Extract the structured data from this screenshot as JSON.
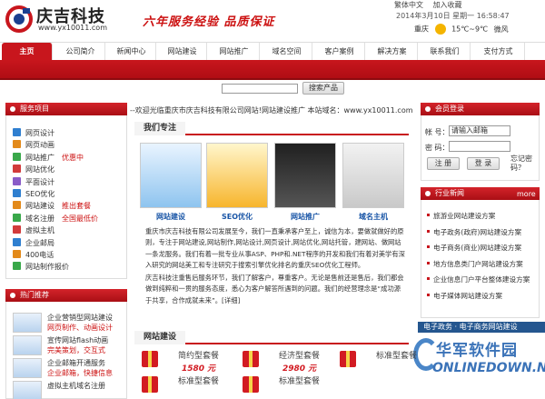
{
  "header": {
    "logo_name": "庆吉科技",
    "logo_url": "www.yx10011.com",
    "slogan": "六年服务经验  品质保证",
    "top_links": [
      "繁体中文",
      "加入收藏"
    ],
    "dateline": "2014年3月10日 星期一  16:58:47",
    "weather": {
      "city": "重庆",
      "temp": "15℃~9℃",
      "wind": "微风"
    }
  },
  "nav": {
    "items": [
      "主页",
      "公司简介",
      "新闻中心",
      "网站建设",
      "网站推广",
      "域名空间",
      "客户案例",
      "解决方案",
      "联系我们",
      "支付方式"
    ],
    "active_index": 0
  },
  "search": {
    "placeholder": "",
    "button": "搜索产品"
  },
  "notice": "--欢迎光临重庆市庆吉科技有限公司网站!网站建设推广  本站域名：www.yx10011.com",
  "services": {
    "title": "服务项目",
    "items": [
      {
        "label": "网页设计",
        "hot": "",
        "color": "#2f7fd0"
      },
      {
        "label": "网页动画",
        "hot": "",
        "color": "#e38a1a"
      },
      {
        "label": "网站推广",
        "hot": "优惠中",
        "color": "#39a84a"
      },
      {
        "label": "网站优化",
        "hot": "",
        "color": "#d23b3b"
      },
      {
        "label": "平面设计",
        "hot": "",
        "color": "#8a5cc8"
      },
      {
        "label": "SEO优化",
        "hot": "",
        "color": "#2f7fd0"
      },
      {
        "label": "网站建设",
        "hot": "推出套餐",
        "color": "#e38a1a"
      },
      {
        "label": "域名注册",
        "hot": "全国最低价",
        "color": "#39a84a"
      },
      {
        "label": "虚拟主机",
        "hot": "",
        "color": "#d23b3b"
      },
      {
        "label": "企业邮局",
        "hot": "",
        "color": "#2f7fd0"
      },
      {
        "label": "400电话",
        "hot": "",
        "color": "#e38a1a"
      },
      {
        "label": "网站制作报价",
        "hot": "",
        "color": "#39a84a"
      }
    ]
  },
  "hot": {
    "title": "热门推荐",
    "items": [
      {
        "title": "企业营销型网站建设",
        "sub": "网页制作、动画设计"
      },
      {
        "title": "宣传网站flash动画",
        "sub": "完美策划，交互式"
      },
      {
        "title": "企业邮箱开通服务",
        "sub": "企业邮箱，快捷信息"
      },
      {
        "title": "虚拟主机域名注册",
        "sub": ""
      }
    ]
  },
  "focus": {
    "title": "我们专注",
    "items": [
      "网站建设",
      "SEO优化",
      "网站推广",
      "域名主机"
    ]
  },
  "intro": {
    "p1": "重庆市庆吉科技有限公司发展至今，我们一直秉承客户至上，诚信为本，要做就做好的原则，专注于网站建设,网站制作,网站设计,网页设计,网站优化,网站托管，建网站、做网站一条龙服务。我们有着一批专业从事ASP、PHP和.NET程序的开发和我们有着对美学有深入研究的网站美工和专注研究于搜索引擎优化排名的重庆SEO优化工程师。",
    "p2": "庆吉科技注重售后服务环节，我们了解客户，尊重客户。无论是售前还是售后，我们都会做到纯粹和一贯的服务态度，悉心为客户解答所遇到的问题。我们的经营理念是“成功源于共享，合作成就未来”。[详细]"
  },
  "web": {
    "title": "网站建设",
    "packages": [
      {
        "name": "简约型套餐",
        "price": "1580 元"
      },
      {
        "name": "经济型套餐",
        "price": "2980 元"
      },
      {
        "name": "标准型套餐",
        "price": ""
      },
      {
        "name": "标准型套餐",
        "price": ""
      },
      {
        "name": "标准型套餐",
        "price": ""
      }
    ]
  },
  "member": {
    "title": "会员登录",
    "account_label": "帐  号：",
    "account_placeholder": "请输入邮箱",
    "password_label": "密  码：",
    "login": "注 册",
    "register": "登 录",
    "forgot": "忘记密码？"
  },
  "news": {
    "title": "行业新闻",
    "more": "more",
    "items": [
      "旅游业网站建设方案",
      "电子政务(政府)网站建设方案",
      "电子商务(商业)网站建设方案",
      "地方信息类门户网站建设方案",
      "企业信息门户平台整体建设方案",
      "电子媒体网站建设方案"
    ]
  },
  "strip": "电子政务 · 电子商务网站建设",
  "watermark": {
    "cn": "华军软件园",
    "en": "ONLINEDOWN.NET"
  },
  "colors": {
    "brand_red": "#c8161d",
    "link_blue": "#1a56a7"
  }
}
